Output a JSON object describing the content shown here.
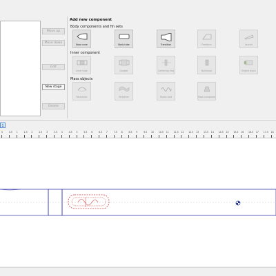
{
  "buttons": {
    "move_up": "Move up",
    "move_down": "Move down",
    "edit": "Edit",
    "new_stage": "New stage",
    "delete": "Delete"
  },
  "panel": {
    "title": "Add new component",
    "body_section": "Body components and fin sets",
    "inner_section": "Inner component",
    "mass_section": "Mass objects",
    "body_components": [
      {
        "label": "Nose cone",
        "icon": "nose-cone-icon",
        "enabled": true
      },
      {
        "label": "Body tube",
        "icon": "body-tube-icon",
        "enabled": true
      },
      {
        "label": "Transition",
        "icon": "transition-icon",
        "enabled": true
      },
      {
        "label": "Freeform",
        "icon": "fin-icon",
        "enabled": false
      },
      {
        "label": "Launch",
        "icon": "launch-lug-icon",
        "enabled": false
      }
    ],
    "inner_components": [
      {
        "label": "Inner tube",
        "icon": "inner-tube-icon",
        "enabled": false
      },
      {
        "label": "Coupler",
        "icon": "coupler-icon",
        "enabled": false
      },
      {
        "label": "Centering ring",
        "icon": "centering-ring-icon",
        "enabled": false
      },
      {
        "label": "Bulkhead",
        "icon": "bulkhead-icon",
        "enabled": false
      },
      {
        "label": "Engine block",
        "icon": "engine-block-icon",
        "enabled": false
      }
    ],
    "mass_components": [
      {
        "label": "Parachute",
        "icon": "parachute-icon",
        "enabled": false
      },
      {
        "label": "Streamer",
        "icon": "streamer-icon",
        "enabled": false
      },
      {
        "label": "Shock cord",
        "icon": "shock-cord-icon",
        "enabled": false
      },
      {
        "label": "Mass component",
        "icon": "mass-icon",
        "enabled": false
      }
    ]
  },
  "stage_tab": "1",
  "ruler_labels": [
    "0",
    "0.5",
    "1",
    "1.5",
    "2",
    "2.5",
    "3",
    "3.5",
    "4",
    "4.5",
    "5",
    "5.5",
    "6",
    "6.5",
    "7",
    "7.5",
    "8",
    "8.5",
    "9",
    "9.5",
    "10",
    "10.5",
    "11",
    "11.5",
    "12",
    "12.5",
    "13",
    "13.5",
    "14",
    "14.5",
    "15",
    "15.5",
    "16",
    "16.5",
    "17",
    "17.5",
    "18"
  ],
  "colors": {
    "rocket_outline": "#3b3bb0",
    "parachute_outline": "#d23a3a",
    "cg_marker": "#2a3a9a"
  }
}
